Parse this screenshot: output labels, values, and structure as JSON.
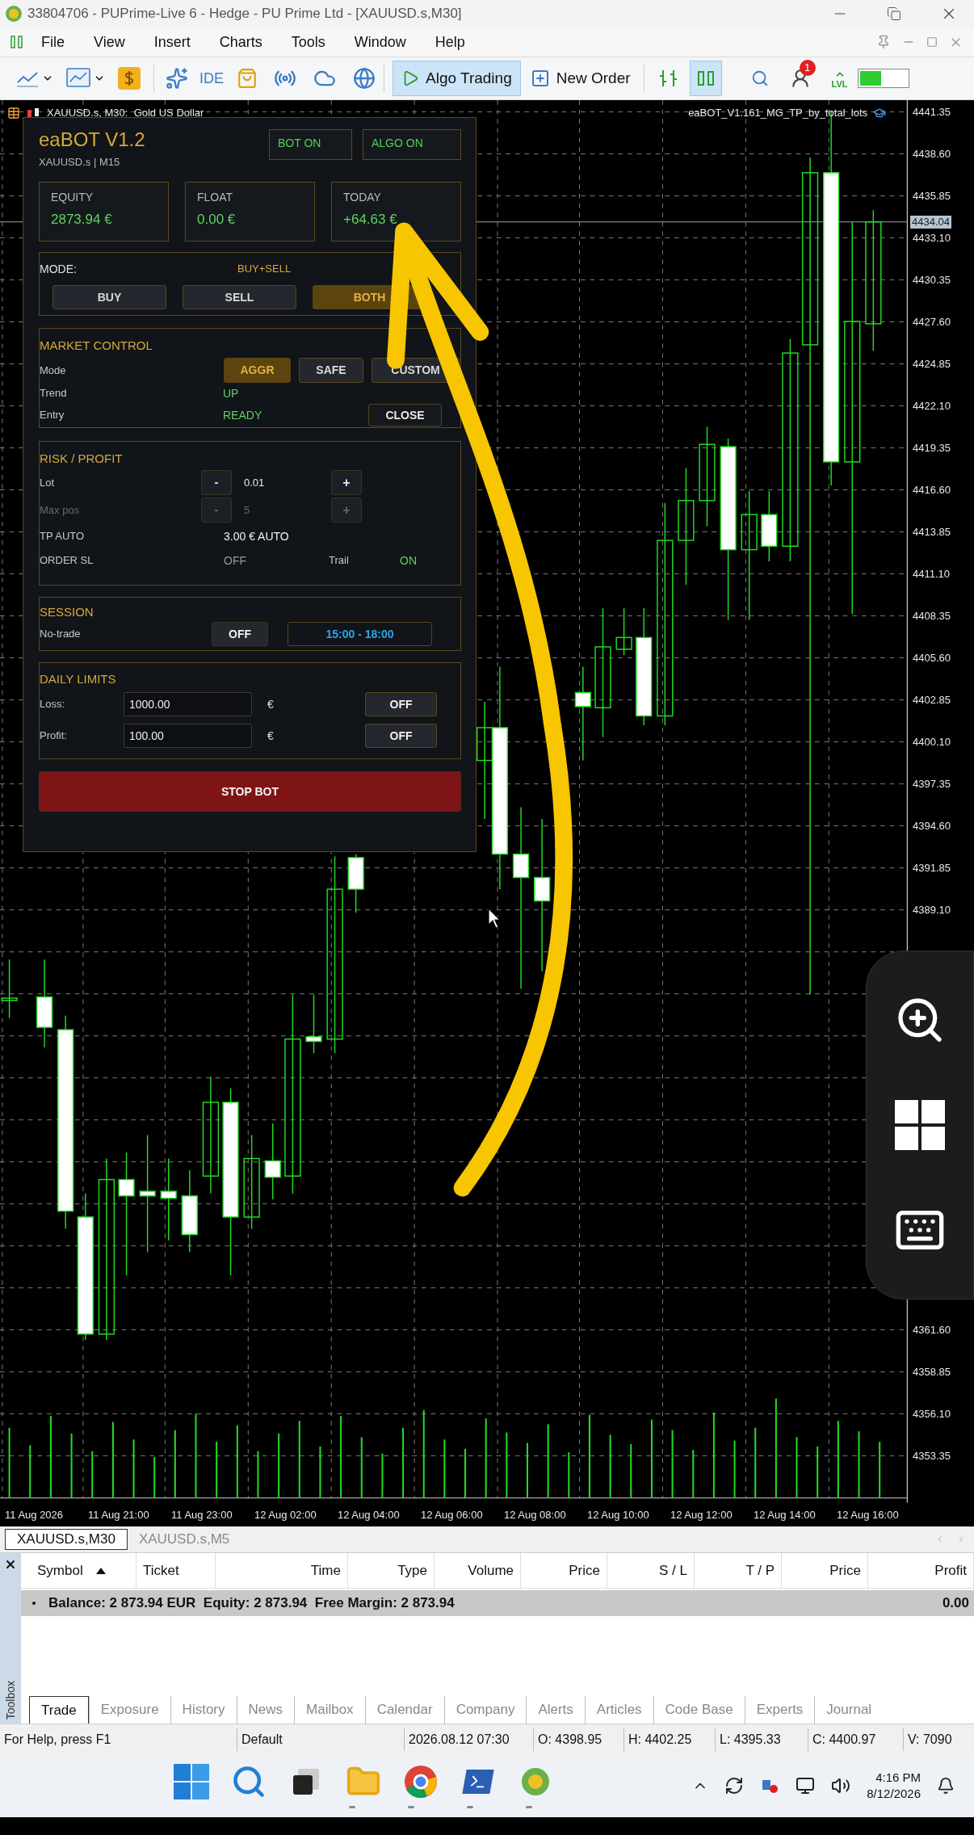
{
  "window": {
    "title": "33804706 - PUPrime-Live 6 - Hedge - PU Prime Ltd - [XAUUSD.s,M30]"
  },
  "menu": [
    "File",
    "View",
    "Insert",
    "Charts",
    "Tools",
    "Window",
    "Help"
  ],
  "toolbar": {
    "ide": "IDE",
    "algo_trading": {
      "label": "Algo Trading",
      "on": true
    },
    "new_order": "New Order",
    "notifications": "1",
    "levels": "LVL"
  },
  "chart": {
    "symbol": "XAUUSD.s, M30:  Gold US Dollar",
    "expert": "eaBOT_V1.161_MG_TP_by_total_lots",
    "current_price": "4434.04",
    "price_labels": [
      "4441.35",
      "4438.60",
      "4435.85",
      "4433.10",
      "4430.35",
      "4427.60",
      "4424.85",
      "4422.10",
      "4419.35",
      "4416.60",
      "4413.85",
      "4411.10",
      "4408.35",
      "4405.60",
      "4402.85",
      "4400.10",
      "4397.35",
      "4394.60",
      "4391.85",
      "4389.10",
      "4361.60",
      "4358.85",
      "4356.10",
      "4353.35"
    ],
    "time_labels": [
      "11 Aug 2026",
      "11 Aug 21:00",
      "11 Aug 23:00",
      "12 Aug 02:00",
      "12 Aug 04:00",
      "12 Aug 06:00",
      "12 Aug 08:00",
      "12 Aug 10:00",
      "12 Aug 12:00",
      "12 Aug 14:00",
      "12 Aug 16:00"
    ]
  },
  "panel": {
    "title": "eaBOT V1.2",
    "badges": [
      "BOT ON",
      "ALGO ON"
    ],
    "subtitle": "XAUUSD.s | M15",
    "stats": [
      {
        "label": "EQUITY",
        "value": "2873.94 €"
      },
      {
        "label": "FLOAT",
        "value": "0.00 €"
      },
      {
        "label": "TODAY",
        "value": "+64.63 €"
      }
    ],
    "mode": {
      "label": "MODE:",
      "value": "BUY+SELL",
      "options": [
        {
          "label": "BUY",
          "selected": false
        },
        {
          "label": "SELL",
          "selected": false
        },
        {
          "label": "BOTH",
          "selected": true
        }
      ]
    },
    "market_control": {
      "title": "MARKET CONTROL",
      "mode_label": "Mode",
      "modes": [
        {
          "label": "AGGR",
          "selected": true
        },
        {
          "label": "SAFE",
          "selected": false
        },
        {
          "label": "CUSTOM",
          "selected": false
        }
      ],
      "trend_label": "Trend",
      "trend": "UP",
      "entry_label": "Entry",
      "entry": "READY",
      "close": "CLOSE"
    },
    "risk": {
      "title": "RISK / PROFIT",
      "steppers": [
        {
          "label": "Lot",
          "minus": "-",
          "value": "0.01",
          "plus": "+",
          "disabled": false
        },
        {
          "label": "Max pos",
          "minus": "-",
          "value": "5",
          "plus": "+",
          "disabled": true
        }
      ],
      "tp_label": "TP AUTO",
      "tp": "3.00 € AUTO",
      "sl_label": "ORDER SL",
      "sl": {
        "text": "OFF",
        "on": false
      },
      "trail_label": "Trail",
      "trail": {
        "text": "ON",
        "on": true
      }
    },
    "session": {
      "title": "SESSION",
      "label": "No-trade",
      "toggle": "OFF",
      "hours": "15:00 - 18:00"
    },
    "limits": {
      "title": "DAILY LIMITS",
      "rows": [
        {
          "label": "Loss:",
          "value": "1000.00",
          "currency": "€",
          "toggle": "OFF"
        },
        {
          "label": "Profit:",
          "value": "100.00",
          "currency": "€",
          "toggle": "OFF"
        }
      ]
    },
    "stop": "STOP BOT"
  },
  "chart_tabs": [
    {
      "label": "XAUUSD.s,M30",
      "selected": true
    },
    {
      "label": "XAUUSD.s,M5",
      "selected": false
    }
  ],
  "toolbox": {
    "label": "Toolbox",
    "columns": [
      {
        "label": "Symbol",
        "sorted": true
      },
      {
        "label": "Ticket",
        "sorted": false
      },
      {
        "label": "Time",
        "sorted": false
      },
      {
        "label": "Type",
        "sorted": false
      },
      {
        "label": "Volume",
        "sorted": false
      },
      {
        "label": "Price",
        "sorted": false
      },
      {
        "label": "S / L",
        "sorted": false
      },
      {
        "label": "T / P",
        "sorted": false
      },
      {
        "label": "Price",
        "sorted": false
      },
      {
        "label": "Profit",
        "sorted": false
      }
    ],
    "balance_row": {
      "summary": "Balance: 2 873.94 EUR  Equity: 2 873.94  Free Margin: 2 873.94",
      "profit": "0.00"
    },
    "tabs": [
      {
        "label": "Trade",
        "selected": true
      },
      {
        "label": "Exposure",
        "selected": false
      },
      {
        "label": "History",
        "selected": false
      },
      {
        "label": "News",
        "selected": false
      },
      {
        "label": "Mailbox",
        "selected": false
      },
      {
        "label": "Calendar",
        "selected": false
      },
      {
        "label": "Company",
        "selected": false
      },
      {
        "label": "Alerts",
        "selected": false
      },
      {
        "label": "Articles",
        "selected": false
      },
      {
        "label": "Code Base",
        "selected": false
      },
      {
        "label": "Experts",
        "selected": false
      },
      {
        "label": "Journal",
        "selected": false
      }
    ]
  },
  "status_bar": [
    "For Help, press F1",
    "Default",
    "2026.08.12 07:30",
    "O: 4398.95",
    "H: 4402.25",
    "L: 4395.33",
    "C: 4400.97",
    "V: 7090"
  ],
  "taskbar": {
    "time": "4:16 PM",
    "date": "8/12/2026"
  }
}
